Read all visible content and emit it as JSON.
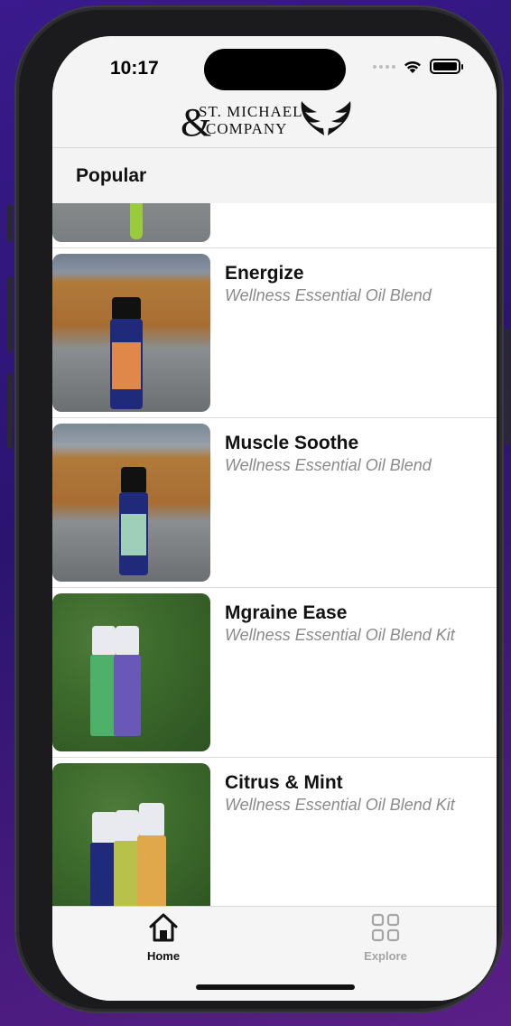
{
  "status_bar": {
    "time": "10:17"
  },
  "header": {
    "logo_ampersand": "&",
    "logo_line1": "ST. MICHAEL",
    "logo_line2": "COMPANY"
  },
  "section": {
    "title": "Popular"
  },
  "products": [
    {
      "name": "",
      "subtitle": ""
    },
    {
      "name": "Energize",
      "subtitle": "Wellness Essential Oil Blend"
    },
    {
      "name": "Muscle Soothe",
      "subtitle": "Wellness Essential Oil Blend"
    },
    {
      "name": "Mgraine Ease",
      "subtitle": "Wellness Essential Oil Blend Kit"
    },
    {
      "name": "Citrus & Mint",
      "subtitle": "Wellness Essential Oil Blend Kit"
    }
  ],
  "tabbar": {
    "tabs": [
      {
        "label": "Home",
        "icon": "home-icon",
        "selected": true
      },
      {
        "label": "Explore",
        "icon": "grid-icon",
        "selected": false
      }
    ]
  },
  "colors": {
    "selected_tab": "#111111",
    "unselected_tab": "#a5a5a5",
    "subtitle": "#8a8a8a"
  }
}
